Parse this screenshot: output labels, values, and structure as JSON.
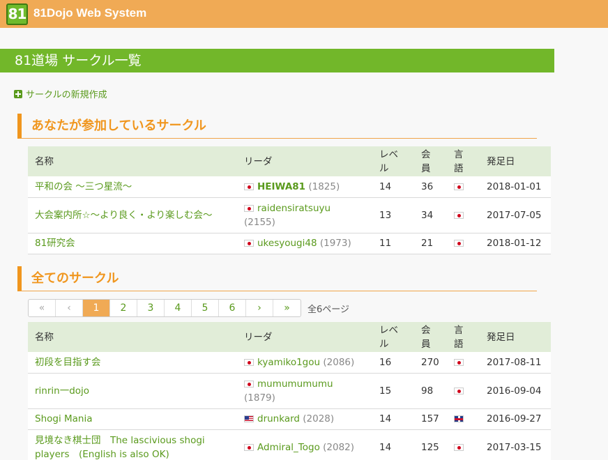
{
  "app": {
    "logo_text": "81",
    "title": "81Dojo Web System"
  },
  "page": {
    "title": "81道場 サークル一覧"
  },
  "create_link": "サークルの新規作成",
  "sections": {
    "mine": "あなたが参加しているサークル",
    "all": "全てのサークル"
  },
  "columns": {
    "name": "名称",
    "leader": "リーダ",
    "level_1": "レベ",
    "level_2": "ル",
    "members_1": "会",
    "members_2": "員",
    "lang_1": "言",
    "lang_2": "語",
    "founded": "発足日"
  },
  "my_circles": [
    {
      "name": "平和の会 〜三つ星流〜",
      "leader": "HEIWA81",
      "rating": "(1825)",
      "level": "14",
      "members": "36",
      "lang": "jp",
      "founded": "2018-01-01"
    },
    {
      "name": "大会案内所☆〜より良く・より楽しむ会〜",
      "leader": "raidensiratsuyu",
      "rating": "(2155)",
      "level": "13",
      "members": "34",
      "lang": "jp",
      "founded": "2017-07-05"
    },
    {
      "name": "81研究会",
      "leader": "ukesyougi48",
      "rating": "(1973)",
      "level": "11",
      "members": "21",
      "lang": "jp",
      "founded": "2018-01-12"
    }
  ],
  "pagination": {
    "first": "«",
    "prev": "‹",
    "pages": [
      "1",
      "2",
      "3",
      "4",
      "5",
      "6"
    ],
    "current": "1",
    "next": "›",
    "last": "»",
    "total": "全6ページ"
  },
  "all_circles": [
    {
      "name": "初段を目指す会",
      "leader": "kyamiko1gou",
      "rating": "(2086)",
      "level": "16",
      "members": "270",
      "lang": "jp",
      "founded": "2017-08-11"
    },
    {
      "name": "rinrin一dojo",
      "leader": "mumumumumu",
      "rating": "(1879)",
      "level": "15",
      "members": "98",
      "lang": "jp",
      "founded": "2016-09-04"
    },
    {
      "name": "Shogi Mania",
      "leader": "drunkard",
      "rating": "(2028)",
      "level": "14",
      "members": "157",
      "lang": "gb",
      "founded": "2016-09-27"
    },
    {
      "name_1": "見境なき棋士団　The lascivious shogi",
      "name_2": "players　(English is also OK)",
      "leader": "Admiral_Togo",
      "rating": "(2082)",
      "level": "14",
      "members": "125",
      "lang": "jp",
      "founded": "2017-03-15"
    }
  ]
}
